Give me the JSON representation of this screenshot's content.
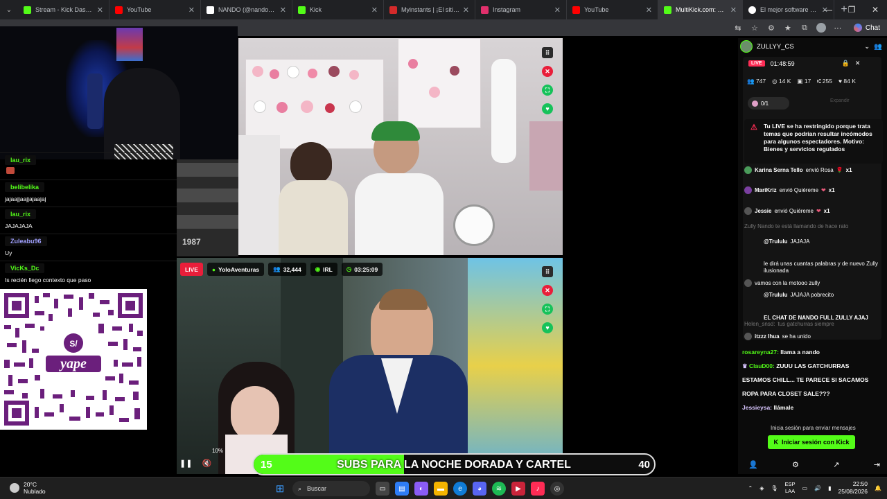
{
  "browser": {
    "tabs": [
      {
        "title": "Stream - Kick Dashboard",
        "favicon_color": "#53fc18"
      },
      {
        "title": "YouTube",
        "favicon_color": "#ff0000"
      },
      {
        "title": "NANDO (@nandoweed",
        "favicon_color": "#ffffff"
      },
      {
        "title": "Kick",
        "favicon_color": "#53fc18"
      },
      {
        "title": "Myinstants | ¡El sitio web",
        "favicon_color": "#d42a2a"
      },
      {
        "title": "Instagram",
        "favicon_color": "#e1306c"
      },
      {
        "title": "YouTube",
        "favicon_color": "#ff0000"
      },
      {
        "title": "MultiKick.com: Wat",
        "favicon_color": "#53fc18"
      },
      {
        "title": "El mejor software para",
        "favicon_color": "#ffffff"
      }
    ],
    "new_tab": "+",
    "chat_label": "Chat"
  },
  "left_chat": {
    "messages": [
      {
        "user": "lau_rix",
        "text": "",
        "color": "#53fc18"
      },
      {
        "user": "belibelika",
        "text": "jajaajjaajjajaajaj",
        "color": "#53fc18"
      },
      {
        "user": "lau_rix",
        "text": "JAJAJAJA",
        "color": "#53fc18"
      },
      {
        "user": "Zuleabu96",
        "text": "Uy",
        "color": "#a0a0ff"
      },
      {
        "user": "VicKs_Dc",
        "text": "Is recién llego contexto que paso",
        "color": "#53fc18"
      }
    ]
  },
  "overlay_number": "1987",
  "stream2": {
    "live": "LIVE",
    "channel": "YoloAventuras",
    "viewers": "32,444",
    "category": "IRL",
    "uptime": "03:25:09",
    "volume": "10%"
  },
  "banner": {
    "left": "15",
    "text": "SUBS PARA LA NOCHE DORADA Y CARTEL",
    "right": "40",
    "progress": 0.375
  },
  "right_panel": {
    "streamer": "ZULLYY_CS",
    "tiktok": {
      "live": "LIVE",
      "timer": "01:48:59",
      "stats": [
        "747",
        "14 K",
        "17",
        "255",
        "84 K"
      ],
      "gift_count": "0/1",
      "expand": "Expandir",
      "warning": "Tu LIVE se ha restringido porque trata temas que podrían resultar incómodos para algunos espectadores. Motivo: Bienes y servicios regulados",
      "messages": [
        {
          "name": "Karina Serna Tello",
          "text": "envió Rosa",
          "count": "x1"
        },
        {
          "name": "MariKriz",
          "text": "envió Quiéreme",
          "count": "x1"
        },
        {
          "name": "Jessie",
          "text": "envió Quiéreme",
          "count": "x1"
        },
        {
          "name": "",
          "text": "Zully Nando te está llamando de hace rato",
          "count": ""
        },
        {
          "name": "@Trululu",
          "text": "JAJAJA",
          "count": ""
        },
        {
          "name": "",
          "text": "le dirá unas cuantas palabras y de nuevo Zully ilusionada",
          "count": ""
        },
        {
          "name": "",
          "text": "vamos con la motooo zully",
          "count": ""
        },
        {
          "name": "@Trululu",
          "text": "JAJAJA pobrecito",
          "count": ""
        },
        {
          "name": "",
          "text": "EL CHAT DE NANDO FULL ZULLY AJAJ",
          "count": ""
        },
        {
          "name": "Helen_snsd:",
          "text": "tus gatchurras siempre",
          "count": ""
        },
        {
          "name": "itzzz Ihua",
          "text": "se ha unido",
          "count": ""
        }
      ]
    },
    "kick_messages": [
      {
        "user": "rosareyna27:",
        "text": "llama a nando"
      },
      {
        "user": "ClauD00:",
        "text": "ZUUU LAS GATCHURRAS"
      },
      {
        "user": "",
        "text": "ESTAMOS CHILL... TE PARECE SI SACAMOS"
      },
      {
        "user": "",
        "text": "ROPA PARA CLOSET SALE???"
      },
      {
        "user": "Jessieysa:",
        "text": "llámale"
      }
    ],
    "login_hint": "Inicia sesión para enviar mensajes",
    "login_button": "Iniciar sesión con Kick"
  },
  "taskbar": {
    "temperature": "20°C",
    "weather": "Nublado",
    "search": "Buscar",
    "lang1": "ESP",
    "lang2": "LAA",
    "time": "22:50",
    "date": "25/08/2026"
  }
}
